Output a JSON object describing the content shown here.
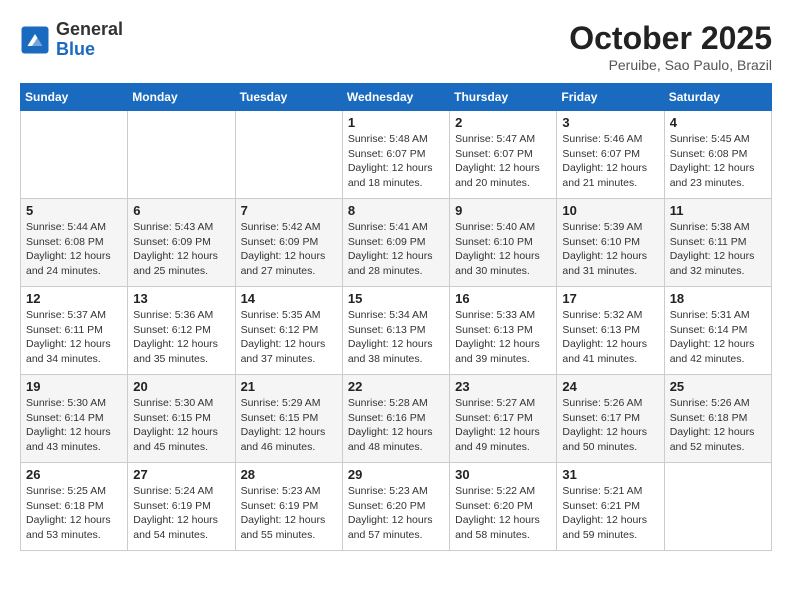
{
  "header": {
    "logo_line1": "General",
    "logo_line2": "Blue",
    "month": "October 2025",
    "location": "Peruibe, Sao Paulo, Brazil"
  },
  "weekdays": [
    "Sunday",
    "Monday",
    "Tuesday",
    "Wednesday",
    "Thursday",
    "Friday",
    "Saturday"
  ],
  "weeks": [
    [
      {
        "day": "",
        "info": ""
      },
      {
        "day": "",
        "info": ""
      },
      {
        "day": "",
        "info": ""
      },
      {
        "day": "1",
        "info": "Sunrise: 5:48 AM\nSunset: 6:07 PM\nDaylight: 12 hours\nand 18 minutes."
      },
      {
        "day": "2",
        "info": "Sunrise: 5:47 AM\nSunset: 6:07 PM\nDaylight: 12 hours\nand 20 minutes."
      },
      {
        "day": "3",
        "info": "Sunrise: 5:46 AM\nSunset: 6:07 PM\nDaylight: 12 hours\nand 21 minutes."
      },
      {
        "day": "4",
        "info": "Sunrise: 5:45 AM\nSunset: 6:08 PM\nDaylight: 12 hours\nand 23 minutes."
      }
    ],
    [
      {
        "day": "5",
        "info": "Sunrise: 5:44 AM\nSunset: 6:08 PM\nDaylight: 12 hours\nand 24 minutes."
      },
      {
        "day": "6",
        "info": "Sunrise: 5:43 AM\nSunset: 6:09 PM\nDaylight: 12 hours\nand 25 minutes."
      },
      {
        "day": "7",
        "info": "Sunrise: 5:42 AM\nSunset: 6:09 PM\nDaylight: 12 hours\nand 27 minutes."
      },
      {
        "day": "8",
        "info": "Sunrise: 5:41 AM\nSunset: 6:09 PM\nDaylight: 12 hours\nand 28 minutes."
      },
      {
        "day": "9",
        "info": "Sunrise: 5:40 AM\nSunset: 6:10 PM\nDaylight: 12 hours\nand 30 minutes."
      },
      {
        "day": "10",
        "info": "Sunrise: 5:39 AM\nSunset: 6:10 PM\nDaylight: 12 hours\nand 31 minutes."
      },
      {
        "day": "11",
        "info": "Sunrise: 5:38 AM\nSunset: 6:11 PM\nDaylight: 12 hours\nand 32 minutes."
      }
    ],
    [
      {
        "day": "12",
        "info": "Sunrise: 5:37 AM\nSunset: 6:11 PM\nDaylight: 12 hours\nand 34 minutes."
      },
      {
        "day": "13",
        "info": "Sunrise: 5:36 AM\nSunset: 6:12 PM\nDaylight: 12 hours\nand 35 minutes."
      },
      {
        "day": "14",
        "info": "Sunrise: 5:35 AM\nSunset: 6:12 PM\nDaylight: 12 hours\nand 37 minutes."
      },
      {
        "day": "15",
        "info": "Sunrise: 5:34 AM\nSunset: 6:13 PM\nDaylight: 12 hours\nand 38 minutes."
      },
      {
        "day": "16",
        "info": "Sunrise: 5:33 AM\nSunset: 6:13 PM\nDaylight: 12 hours\nand 39 minutes."
      },
      {
        "day": "17",
        "info": "Sunrise: 5:32 AM\nSunset: 6:13 PM\nDaylight: 12 hours\nand 41 minutes."
      },
      {
        "day": "18",
        "info": "Sunrise: 5:31 AM\nSunset: 6:14 PM\nDaylight: 12 hours\nand 42 minutes."
      }
    ],
    [
      {
        "day": "19",
        "info": "Sunrise: 5:30 AM\nSunset: 6:14 PM\nDaylight: 12 hours\nand 43 minutes."
      },
      {
        "day": "20",
        "info": "Sunrise: 5:30 AM\nSunset: 6:15 PM\nDaylight: 12 hours\nand 45 minutes."
      },
      {
        "day": "21",
        "info": "Sunrise: 5:29 AM\nSunset: 6:15 PM\nDaylight: 12 hours\nand 46 minutes."
      },
      {
        "day": "22",
        "info": "Sunrise: 5:28 AM\nSunset: 6:16 PM\nDaylight: 12 hours\nand 48 minutes."
      },
      {
        "day": "23",
        "info": "Sunrise: 5:27 AM\nSunset: 6:17 PM\nDaylight: 12 hours\nand 49 minutes."
      },
      {
        "day": "24",
        "info": "Sunrise: 5:26 AM\nSunset: 6:17 PM\nDaylight: 12 hours\nand 50 minutes."
      },
      {
        "day": "25",
        "info": "Sunrise: 5:26 AM\nSunset: 6:18 PM\nDaylight: 12 hours\nand 52 minutes."
      }
    ],
    [
      {
        "day": "26",
        "info": "Sunrise: 5:25 AM\nSunset: 6:18 PM\nDaylight: 12 hours\nand 53 minutes."
      },
      {
        "day": "27",
        "info": "Sunrise: 5:24 AM\nSunset: 6:19 PM\nDaylight: 12 hours\nand 54 minutes."
      },
      {
        "day": "28",
        "info": "Sunrise: 5:23 AM\nSunset: 6:19 PM\nDaylight: 12 hours\nand 55 minutes."
      },
      {
        "day": "29",
        "info": "Sunrise: 5:23 AM\nSunset: 6:20 PM\nDaylight: 12 hours\nand 57 minutes."
      },
      {
        "day": "30",
        "info": "Sunrise: 5:22 AM\nSunset: 6:20 PM\nDaylight: 12 hours\nand 58 minutes."
      },
      {
        "day": "31",
        "info": "Sunrise: 5:21 AM\nSunset: 6:21 PM\nDaylight: 12 hours\nand 59 minutes."
      },
      {
        "day": "",
        "info": ""
      }
    ]
  ]
}
